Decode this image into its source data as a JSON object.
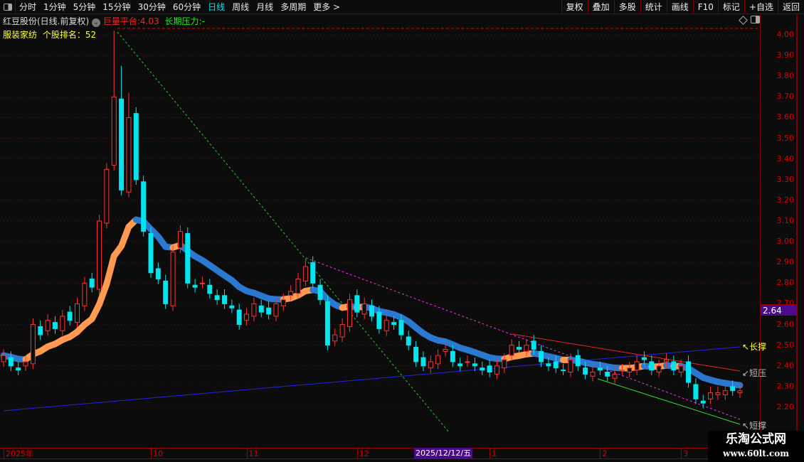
{
  "toolbar": {
    "periods": [
      "分时",
      "1分钟",
      "5分钟",
      "15分钟",
      "30分钟",
      "60分钟",
      "日线",
      "周线",
      "月线",
      "多周期",
      "更多 >"
    ],
    "active": "日线",
    "right": [
      "复权",
      "叠加",
      "多股",
      "统计",
      "画线",
      "F10",
      "标记",
      "+自选",
      "返回"
    ]
  },
  "header": {
    "stock": "红豆股份(日线.前复权)",
    "platform_label": "巨量平台:",
    "platform_value": "4.03",
    "pressure_label": "长期压力:",
    "pressure_value": "-",
    "industry": "服装家纺",
    "rank_label": "个股排名：",
    "rank_value": "52"
  },
  "price_axis": {
    "labels": [
      "4.00",
      "3.90",
      "3.80",
      "3.70",
      "3.60",
      "3.50",
      "3.40",
      "3.30",
      "3.20",
      "3.10",
      "3.00",
      "2.90",
      "2.80",
      "2.70",
      "2.60",
      "2.50",
      "2.40",
      "2.30",
      "2.20"
    ],
    "current": "2.64"
  },
  "time_axis": {
    "labels": [
      {
        "t": "2025年",
        "i": 0
      },
      {
        "t": "10",
        "i": 20
      },
      {
        "t": "11",
        "i": 33
      },
      {
        "t": "12",
        "i": 48
      },
      {
        "t": "1",
        "i": 66
      },
      {
        "t": "2",
        "i": 81
      },
      {
        "t": "3",
        "i": 92
      }
    ],
    "cursor": "2025/12/12/五"
  },
  "annotations": {
    "long_support": "长撑",
    "short_pressure": "短压",
    "short_support": "短撑"
  },
  "colors": {
    "up": "#ff3333",
    "down": "#00e5ee",
    "ma_up": "#ff9a50",
    "ma_down": "#2a78d0"
  },
  "chart_data": {
    "type": "candlestick",
    "close": [
      2.45,
      2.4,
      2.38,
      2.42,
      2.6,
      2.55,
      2.62,
      2.58,
      2.64,
      2.62,
      2.7,
      2.8,
      2.78,
      3.1,
      3.35,
      3.7,
      3.25,
      3.6,
      3.3,
      3.05,
      2.85,
      2.82,
      2.7,
      2.95,
      3.05,
      2.8,
      2.78,
      2.8,
      2.75,
      2.72,
      2.7,
      2.68,
      2.6,
      2.65,
      2.7,
      2.66,
      2.65,
      2.7,
      2.72,
      2.76,
      2.82,
      2.88,
      2.8,
      2.72,
      2.5,
      2.55,
      2.6,
      2.72,
      2.66,
      2.7,
      2.64,
      2.58,
      2.62,
      2.6,
      2.55,
      2.5,
      2.42,
      2.4,
      2.42,
      2.45,
      2.48,
      2.42,
      2.4,
      2.42,
      2.4,
      2.38,
      2.37,
      2.4,
      2.43,
      2.5,
      2.48,
      2.5,
      2.48,
      2.42,
      2.4,
      2.39,
      2.38,
      2.43,
      2.4,
      2.36,
      2.37,
      2.38,
      2.35,
      2.36,
      2.38,
      2.39,
      2.42,
      2.43,
      2.38,
      2.4,
      2.43,
      2.38,
      2.4,
      2.32,
      2.24,
      2.22,
      2.27,
      2.27,
      2.28,
      2.28,
      2.28
    ],
    "high_overrides": {
      "15": 4.02,
      "16": 3.85,
      "17": 3.72
    },
    "ylim": [
      2.1,
      4.05
    ]
  },
  "watermark": {
    "line1": "乐淘公式网",
    "line2": "www.60lt.com"
  }
}
